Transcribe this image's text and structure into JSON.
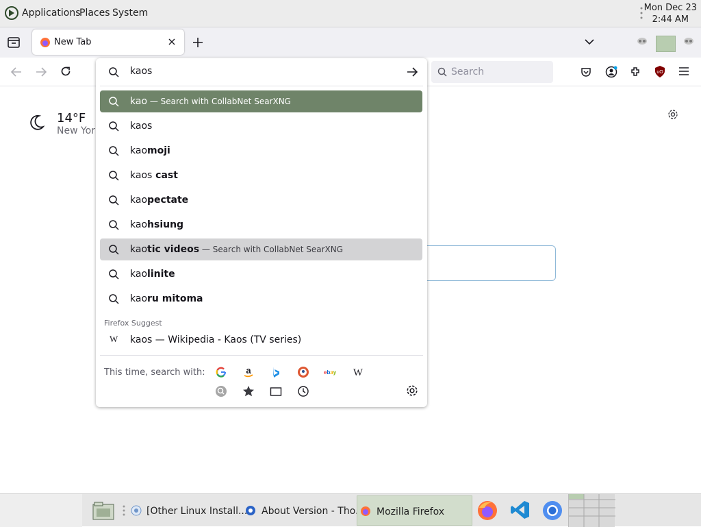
{
  "top_panel": {
    "menus": [
      "Applications",
      "Places",
      "System"
    ],
    "clock_date": "Mon Dec 23",
    "clock_time": "2:44 AM"
  },
  "browser": {
    "tab_title": "New Tab",
    "search_placeholder": "Search",
    "weather": {
      "temperature": "14°F",
      "location": "New York"
    }
  },
  "url_bar": {
    "value": "kaos",
    "suggestions": [
      {
        "prefix": "kao",
        "suffix": "",
        "action": "— Search with CollabNet SearXNG",
        "state": "selected"
      },
      {
        "prefix": "kaos",
        "suffix": "",
        "action": "",
        "state": ""
      },
      {
        "prefix": "kao",
        "suffix": "moji",
        "action": "",
        "state": ""
      },
      {
        "prefix": "kaos",
        "suffix": " cast",
        "action": "",
        "state": ""
      },
      {
        "prefix": "kao",
        "suffix": "pectate",
        "action": "",
        "state": ""
      },
      {
        "prefix": "kao",
        "suffix": "hsiung",
        "action": "",
        "state": ""
      },
      {
        "prefix": "kao",
        "suffix": "tic videos",
        "action": "— Search with CollabNet SearXNG",
        "state": "hover"
      },
      {
        "prefix": "kao",
        "suffix": "linite",
        "action": "",
        "state": ""
      },
      {
        "prefix": "kao",
        "suffix": "ru mitoma",
        "action": "",
        "state": ""
      }
    ],
    "group_label": "Firefox Suggest",
    "wiki_suggestion": "kaos — Wikipedia - Kaos (TV series)",
    "oneoff_label": "This time, search with:",
    "engines": [
      "google-icon",
      "amazon-icon",
      "bing-icon",
      "duckduckgo-icon",
      "ebay-icon",
      "wikipedia-icon"
    ]
  },
  "taskbar": {
    "tasks": [
      "[Other Linux Install...",
      "About Version - Tho...",
      "Mozilla Firefox"
    ]
  },
  "colors": {
    "selected_row": "#6f8469",
    "hover_row": "#d3d3d5",
    "panel_bg": "#ececec"
  }
}
